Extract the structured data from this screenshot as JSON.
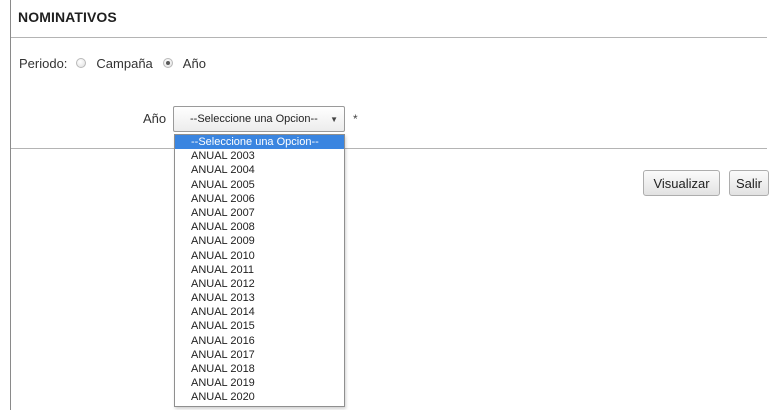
{
  "header": {
    "title": "NOMINATIVOS"
  },
  "periodo": {
    "label": "Periodo:",
    "options": [
      {
        "label": "Campaña",
        "checked": false
      },
      {
        "label": "Año",
        "checked": true
      }
    ]
  },
  "anio": {
    "label": "Año",
    "selected_value": "--Seleccione una Opcion--",
    "required_mark": "*",
    "options": [
      "--Seleccione una Opcion--",
      "ANUAL 2003",
      "ANUAL 2004",
      "ANUAL 2005",
      "ANUAL 2006",
      "ANUAL 2007",
      "ANUAL 2008",
      "ANUAL 2009",
      "ANUAL 2010",
      "ANUAL 2011",
      "ANUAL 2012",
      "ANUAL 2013",
      "ANUAL 2014",
      "ANUAL 2015",
      "ANUAL 2016",
      "ANUAL 2017",
      "ANUAL 2018",
      "ANUAL 2019",
      "ANUAL 2020"
    ],
    "highlighted_index": 0
  },
  "actions": {
    "visualizar_label": "Visualizar",
    "salir_label": "Salir"
  },
  "colors": {
    "highlight": "#3a85e0",
    "rule": "#b4b4b4"
  },
  "icons": {
    "select_arrow": "triangle-down-icon"
  }
}
